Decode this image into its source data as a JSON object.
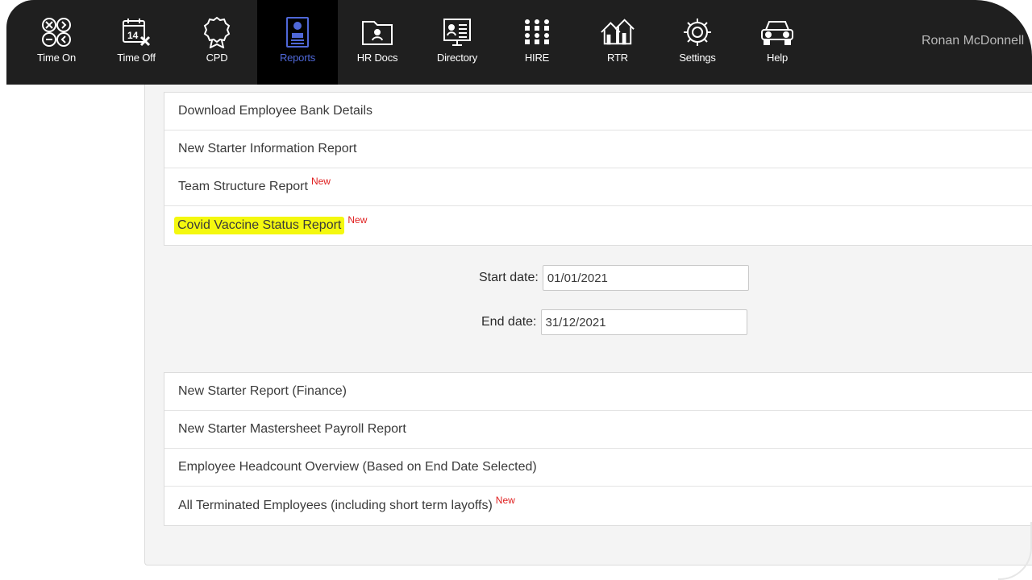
{
  "nav": {
    "items": [
      {
        "label": "Time On",
        "icon": "time-on-icon"
      },
      {
        "label": "Time Off",
        "icon": "calendar-icon",
        "badge": "14"
      },
      {
        "label": "CPD",
        "icon": "award-ribbon-icon"
      },
      {
        "label": "Reports",
        "icon": "reports-icon",
        "active": true
      },
      {
        "label": "HR Docs",
        "icon": "folder-icon"
      },
      {
        "label": "Directory",
        "icon": "directory-icon"
      },
      {
        "label": "HIRE",
        "icon": "people-grid-icon"
      },
      {
        "label": "RTR",
        "icon": "houses-icon"
      },
      {
        "label": "Settings",
        "icon": "gear-icon"
      },
      {
        "label": "Help",
        "icon": "car-icon"
      }
    ],
    "user_name": "Ronan McDonnell",
    "colors": {
      "bar": "#1f1f1f",
      "active_bg": "#000000",
      "active_label": "#4f68d8"
    }
  },
  "reports_top": [
    {
      "label": "Download Employee Bank Details",
      "new": ""
    },
    {
      "label": "New Starter Information Report",
      "new": ""
    },
    {
      "label": "Team Structure Report",
      "new": "New"
    },
    {
      "label": "Covid Vaccine Status Report",
      "new": "New",
      "highlighted": true
    }
  ],
  "date_form": {
    "start_label": "Start date:",
    "start_value": "01/01/2021",
    "end_label": "End date:",
    "end_value": "31/12/2021"
  },
  "reports_bottom": [
    {
      "label": "New Starter Report (Finance)",
      "new": ""
    },
    {
      "label": "New Starter Mastersheet Payroll Report",
      "new": ""
    },
    {
      "label": "Employee Headcount Overview (Based on End Date Selected)",
      "new": ""
    },
    {
      "label": "All Terminated Employees (including short term layoffs)",
      "new": "New"
    }
  ],
  "colors": {
    "new_badge": "#e01e1e",
    "highlight": "#f4f80f"
  }
}
